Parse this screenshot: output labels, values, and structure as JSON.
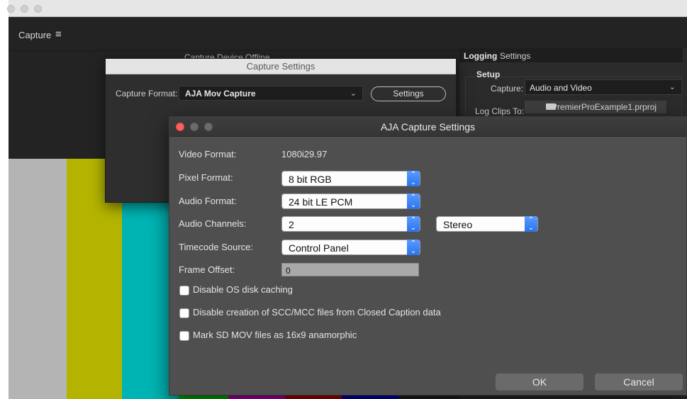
{
  "app": {
    "title": "Capture",
    "menu_icon": "≡"
  },
  "colors": {
    "bars": [
      "#b4b4b4",
      "#b4b400",
      "#00b4b4",
      "#00b400",
      "#b400b4",
      "#b40000",
      "#0000b4"
    ]
  },
  "right_panel": {
    "tabs": [
      "Logging",
      "Settings"
    ],
    "setup_label": "Setup",
    "capture_label": "Capture:",
    "capture_value": "Audio and Video",
    "log_clips_label": "Log Clips To:",
    "log_clips_value": "PremierProExample1.prproj"
  },
  "capture_dialog": {
    "background_text": "Capture Device Offline",
    "title": "Capture Settings",
    "format_label": "Capture Format:",
    "format_value": "AJA Mov Capture",
    "settings_button": "Settings"
  },
  "aja_dialog": {
    "title": "AJA Capture Settings",
    "video_format_label": "Video Format:",
    "video_format_value": "1080i29.97",
    "pixel_format_label": "Pixel Format:",
    "pixel_format_value": "8 bit RGB",
    "audio_format_label": "Audio Format:",
    "audio_format_value": "24 bit LE PCM",
    "audio_channels_label": "Audio Channels:",
    "audio_channels_value": "2",
    "audio_mode_value": "Stereo",
    "timecode_label": "Timecode Source:",
    "timecode_value": "Control Panel",
    "frame_offset_label": "Frame Offset:",
    "frame_offset_value": "0",
    "checkboxes": [
      {
        "label": "Disable OS disk caching",
        "checked": false
      },
      {
        "label": "Disable creation of SCC/MCC files from Closed Caption data",
        "checked": false
      },
      {
        "label": "Mark SD MOV files as 16x9 anamorphic",
        "checked": false
      }
    ],
    "ok_button": "OK",
    "cancel_button": "Cancel"
  }
}
